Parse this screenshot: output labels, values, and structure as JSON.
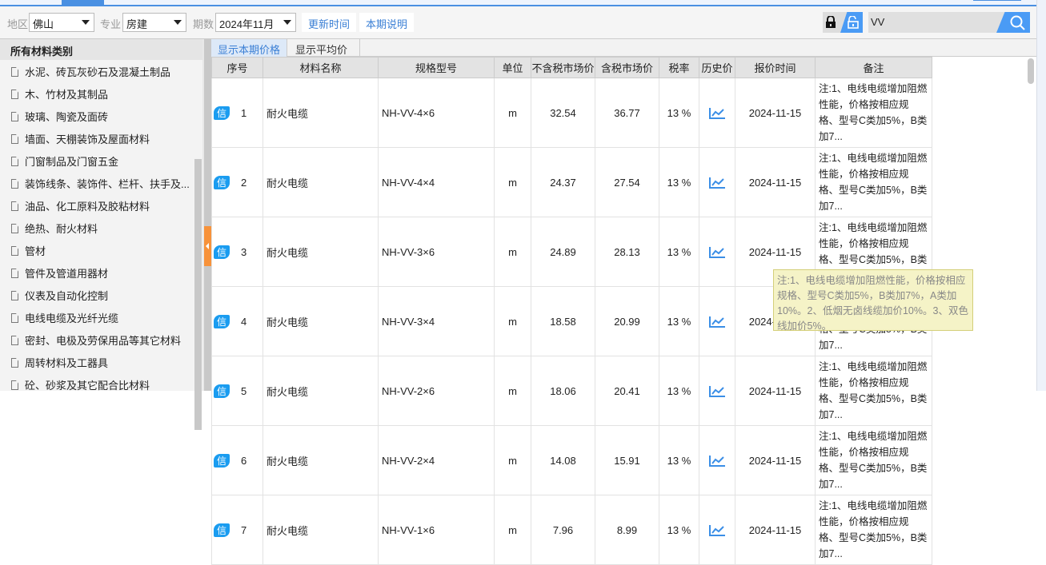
{
  "toolbar": {
    "region_label": "地区",
    "region_value": "佛山",
    "major_label": "专业",
    "major_value": "房建",
    "period_label": "期数",
    "period_value": "2024年11月",
    "update_time_btn": "更新时间",
    "period_note_btn": "本期说明",
    "search_value": "VV"
  },
  "sidebar": {
    "title": "所有材料类别",
    "items": [
      "水泥、砖瓦灰砂石及混凝土制品",
      "木、竹材及其制品",
      "玻璃、陶瓷及面砖",
      "墙面、天棚装饰及屋面材料",
      "门窗制品及门窗五金",
      "装饰线条、装饰件、栏杆、扶手及...",
      "油品、化工原料及胶粘材料",
      "绝热、耐火材料",
      "管材",
      "管件及管道用器材",
      "仪表及自动化控制",
      "电线电缆及光纤光缆",
      "密封、电极及劳保用品等其它材料",
      "周转材料及工器具",
      "砼、砂浆及其它配合比材料"
    ]
  },
  "tabs": {
    "current": "显示本期价格",
    "average": "显示平均价"
  },
  "table": {
    "headers": [
      "序号",
      "材料名称",
      "规格型号",
      "单位",
      "不含税市场价",
      "含税市场价",
      "税率",
      "历史价",
      "报价时间",
      "备注"
    ],
    "badge": "信",
    "note": "注:1、电线电缆增加阻燃性能，价格按相应规格、型号C类加5%，B类加7...",
    "rows": [
      {
        "no": "1",
        "name": "耐火电缆",
        "spec": "NH-VV-4×6",
        "unit": "m",
        "ex_tax": "32.54",
        "inc_tax": "36.77",
        "rate": "13 %",
        "date": "2024-11-15"
      },
      {
        "no": "2",
        "name": "耐火电缆",
        "spec": "NH-VV-4×4",
        "unit": "m",
        "ex_tax": "24.37",
        "inc_tax": "27.54",
        "rate": "13 %",
        "date": "2024-11-15"
      },
      {
        "no": "3",
        "name": "耐火电缆",
        "spec": "NH-VV-3×6",
        "unit": "m",
        "ex_tax": "24.89",
        "inc_tax": "28.13",
        "rate": "13 %",
        "date": "2024-11-15"
      },
      {
        "no": "4",
        "name": "耐火电缆",
        "spec": "NH-VV-3×4",
        "unit": "m",
        "ex_tax": "18.58",
        "inc_tax": "20.99",
        "rate": "13 %",
        "date": "2024-11-15"
      },
      {
        "no": "5",
        "name": "耐火电缆",
        "spec": "NH-VV-2×6",
        "unit": "m",
        "ex_tax": "18.06",
        "inc_tax": "20.41",
        "rate": "13 %",
        "date": "2024-11-15"
      },
      {
        "no": "6",
        "name": "耐火电缆",
        "spec": "NH-VV-2×4",
        "unit": "m",
        "ex_tax": "14.08",
        "inc_tax": "15.91",
        "rate": "13 %",
        "date": "2024-11-15"
      },
      {
        "no": "7",
        "name": "耐火电缆",
        "spec": "NH-VV-1×6",
        "unit": "m",
        "ex_tax": "7.96",
        "inc_tax": "8.99",
        "rate": "13 %",
        "date": "2024-11-15"
      }
    ]
  },
  "tooltip": "注:1、电线电缆增加阻燃性能，价格按相应规格、型号C类加5%，B类加7%，A类加10%。2、低烟无卤线缆加价10%。3、双色线加价5%。"
}
